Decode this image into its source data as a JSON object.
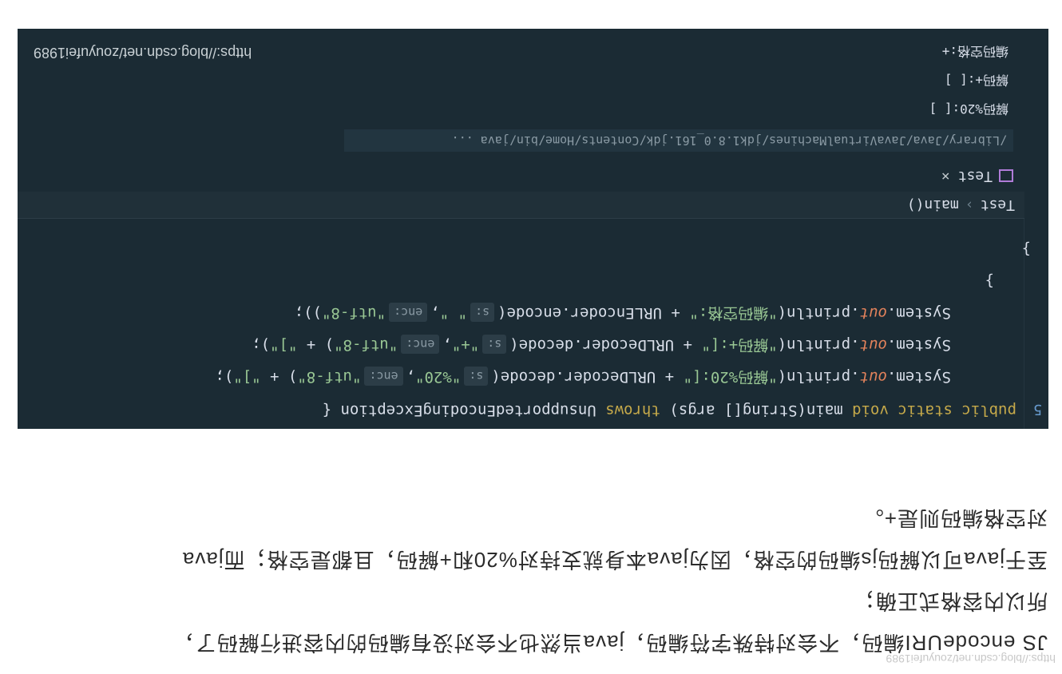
{
  "watermark": "https://blog.csdn.net/zouyufei1989",
  "article": {
    "line1": "JS encodeURI编码，不会对特殊字符编码，java当然也不会对没有编码的内容进行解码了，",
    "line2": "所以内容格式正确；",
    "line3": "至于java可以解码js编码的空格，因为java本身就支持对%20和+解码，且都是空格；而java",
    "line4": "对空格编码则是+。"
  },
  "editor": {
    "line1": {
      "sig_pre": "public static void ",
      "sig_main": "main(String[] args) ",
      "sig_throws": "throws ",
      "sig_post": "UnsupportedEncodingException {"
    },
    "line2": {
      "pre": "System.",
      "out": "out",
      "mid": ".println(",
      "str1": "\"解码%20:[\"",
      "mid2": " + URLDecoder.decode(",
      "hint_s": "s:",
      "arg1": "\"%20\"",
      "hint_enc": "enc:",
      "arg2": "\"utf-8\"",
      "tail": ") + ",
      "str3": "\"]\"",
      "end": ");"
    },
    "line3": {
      "pre": "System.",
      "out": "out",
      "mid": ".println(",
      "str1": "\"解码+:[\"",
      "mid2": " + URLDecoder.decode(",
      "hint_s": "s:",
      "arg1": "\"+\"",
      "hint_enc": "enc:",
      "arg2": "\"utf-8\"",
      "tail": ") + ",
      "str3": "\"]\"",
      "end": ");"
    },
    "line4": {
      "pre": "System.",
      "out": "out",
      "mid": ".println(",
      "str1": "\"编码空格:\"",
      "mid2": " + URLEncoder.encode(",
      "hint_s": "s:",
      "arg1": "\" \"",
      "hint_enc": "enc:",
      "arg2": "\"utf-8\"",
      "end": "));"
    },
    "brace_inner": "}",
    "brace_outer": "}"
  },
  "breadcrumb": {
    "class": "Test",
    "method": "main()"
  },
  "run": {
    "tab_label": "Test",
    "close": "×",
    "command": "/Library/Java/JavaVirtualMachines/jdk1.8.0_161.jdk/Contents/Home/bin/java ...",
    "outputs": [
      "解码%20:[ ]",
      "解码+:[ ]",
      "编码空格:+"
    ],
    "url": "https://blog.csdn.net/zouyufei1989"
  },
  "gutter_number": "5"
}
